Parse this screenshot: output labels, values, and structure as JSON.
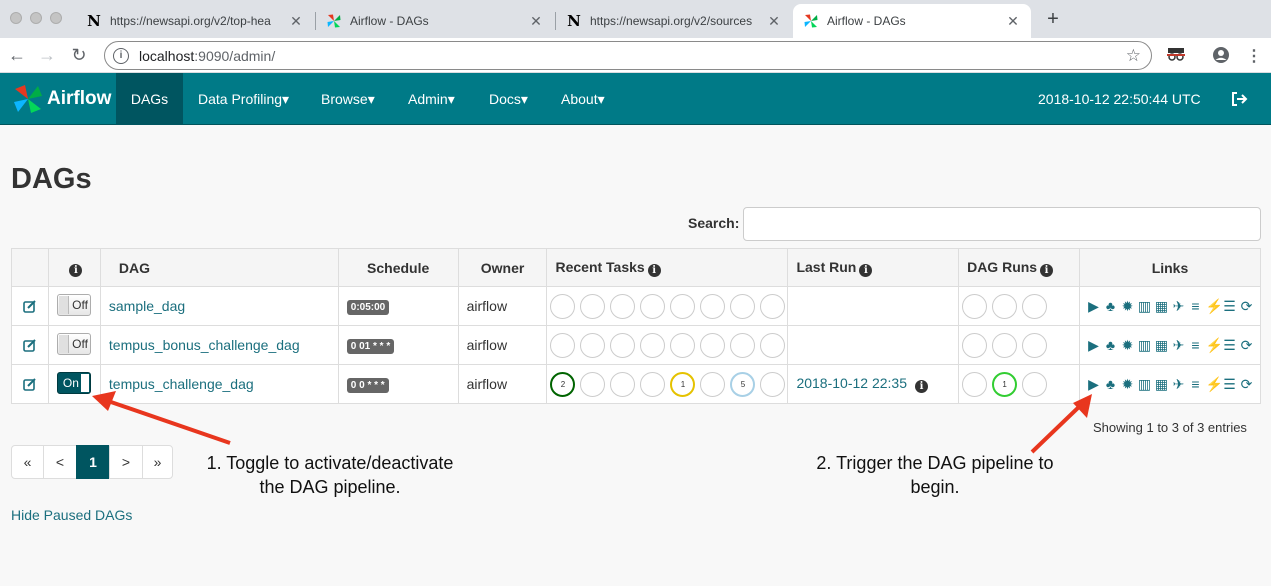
{
  "browser": {
    "tabs": [
      {
        "title": "https://newsapi.org/v2/top-hea",
        "favicon": "N"
      },
      {
        "title": "Airflow - DAGs",
        "favicon": "airflow-pinwheel"
      },
      {
        "title": "https://newsapi.org/v2/sources",
        "favicon": "N"
      },
      {
        "title": "Airflow - DAGs",
        "favicon": "airflow-pinwheel"
      }
    ],
    "url_host": "localhost",
    "url_rest": ":9090/admin/"
  },
  "navbar": {
    "brand": "Airflow",
    "items": [
      "DAGs",
      "Data Profiling",
      "Browse",
      "Admin",
      "Docs",
      "About"
    ],
    "clock": "2018-10-12 22:50:44 UTC"
  },
  "page": {
    "title": "DAGs",
    "search_label": "Search:",
    "search_value": ""
  },
  "table": {
    "headers": {
      "dag": "DAG",
      "schedule": "Schedule",
      "owner": "Owner",
      "recent_tasks": "Recent Tasks",
      "last_run": "Last Run",
      "dag_runs": "DAG Runs",
      "links": "Links"
    },
    "rows": [
      {
        "toggle": "Off",
        "dag": "sample_dag",
        "schedule": "0:05:00",
        "owner": "airflow",
        "last_run": ""
      },
      {
        "toggle": "Off",
        "dag": "tempus_bonus_challenge_dag",
        "schedule": "0 01 * * *",
        "owner": "airflow",
        "last_run": ""
      },
      {
        "toggle": "On",
        "dag": "tempus_challenge_dag",
        "schedule": "0 0 * * *",
        "owner": "airflow",
        "last_run": "2018-10-12 22:35",
        "recent_tasks_counts": [
          "2",
          "1",
          "5"
        ],
        "dag_runs_count": "1"
      }
    ]
  },
  "footer": {
    "showing": "Showing 1 to 3 of 3 entries",
    "pager": [
      "«",
      "<",
      "1",
      ">",
      "»"
    ],
    "hide_paused": "Hide Paused DAGs"
  },
  "annotations": {
    "note1_line1": "1. Toggle to activate/deactivate",
    "note1_line2": "the DAG pipeline.",
    "note2_line1": "2. Trigger the DAG pipeline to",
    "note2_line2": "begin.",
    "arrow_color": "#e8361e"
  },
  "colors": {
    "navbar": "#007a87",
    "accent": "#005560",
    "link": "#1b6f7e"
  }
}
